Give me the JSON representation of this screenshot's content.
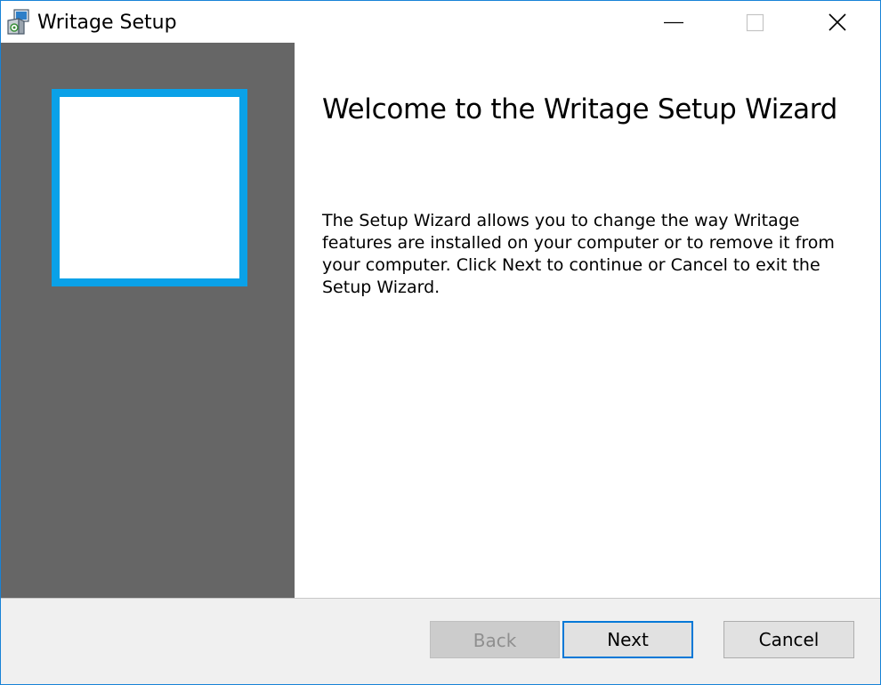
{
  "window": {
    "title": "Writage Setup",
    "icon": "installer-package-icon",
    "controls": {
      "minimize": "minimize-icon",
      "maximize": "maximize-icon",
      "close": "close-icon"
    }
  },
  "banner": {
    "logo": "writage-logo",
    "accent_color": "#0aa1e8",
    "background_color": "#666666"
  },
  "content": {
    "heading": "Welcome to the Writage Setup Wizard",
    "description": "The Setup Wizard allows you to change the way Writage features are installed on your computer or to remove it from your computer. Click Next to continue or Cancel to exit the Setup Wizard."
  },
  "footer": {
    "back_label": "Back",
    "back_enabled": false,
    "next_label": "Next",
    "next_focused": true,
    "cancel_label": "Cancel"
  }
}
